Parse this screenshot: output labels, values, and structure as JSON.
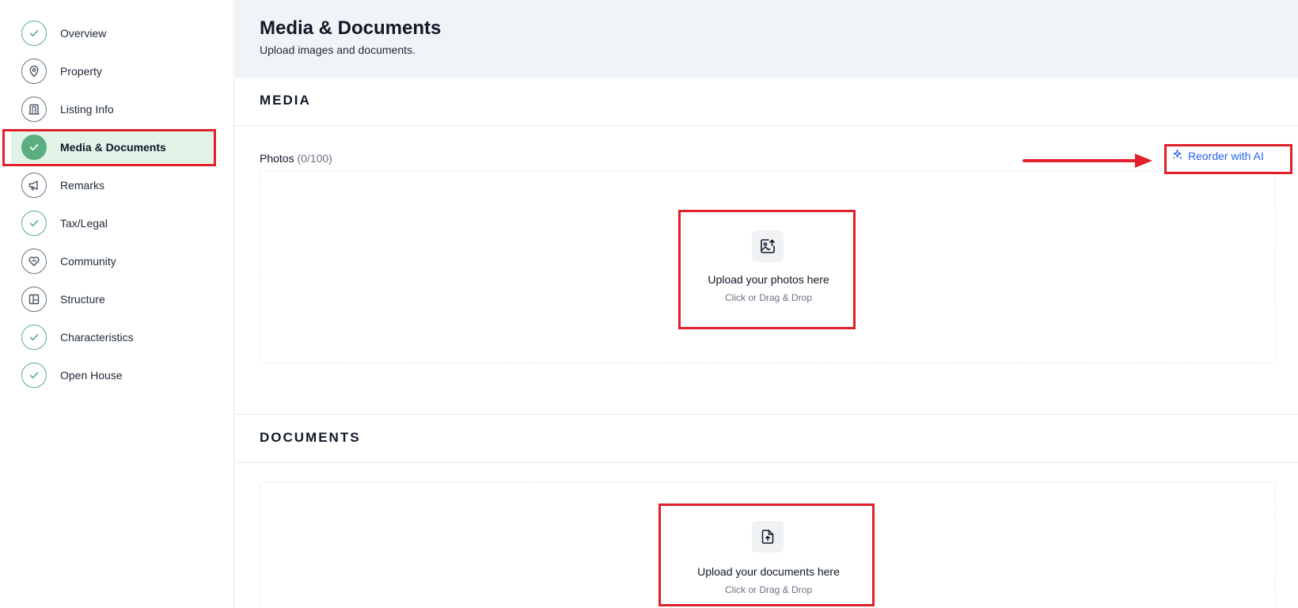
{
  "sidebar": {
    "items": [
      {
        "label": "Overview",
        "state": "done",
        "icon": "check-icon"
      },
      {
        "label": "Property",
        "state": "pending",
        "icon": "map-pin-icon"
      },
      {
        "label": "Listing Info",
        "state": "pending",
        "icon": "door-icon"
      },
      {
        "label": "Media & Documents",
        "state": "active",
        "icon": "check-icon"
      },
      {
        "label": "Remarks",
        "state": "pending",
        "icon": "megaphone-icon"
      },
      {
        "label": "Tax/Legal",
        "state": "done",
        "icon": "check-icon"
      },
      {
        "label": "Community",
        "state": "pending",
        "icon": "heart-handshake-icon"
      },
      {
        "label": "Structure",
        "state": "pending",
        "icon": "floorplan-icon"
      },
      {
        "label": "Characteristics",
        "state": "done",
        "icon": "check-icon"
      },
      {
        "label": "Open House",
        "state": "done",
        "icon": "check-icon"
      }
    ]
  },
  "header": {
    "title": "Media & Documents",
    "subtitle": "Upload images and documents."
  },
  "media": {
    "section_title": "MEDIA",
    "photos_label": "Photos",
    "photos_count": "(0/100)",
    "reorder_label": "Reorder with AI",
    "upload_title": "Upload your photos here",
    "upload_hint": "Click or Drag & Drop"
  },
  "documents": {
    "section_title": "DOCUMENTS",
    "upload_title": "Upload your documents here",
    "upload_hint": "Click or Drag & Drop"
  },
  "colors": {
    "accent_green": "#5aae7f",
    "active_bg": "#e2f3e8",
    "link_blue": "#2563eb",
    "annotation_red": "#e0212b",
    "header_bg": "#f0f4f8"
  }
}
